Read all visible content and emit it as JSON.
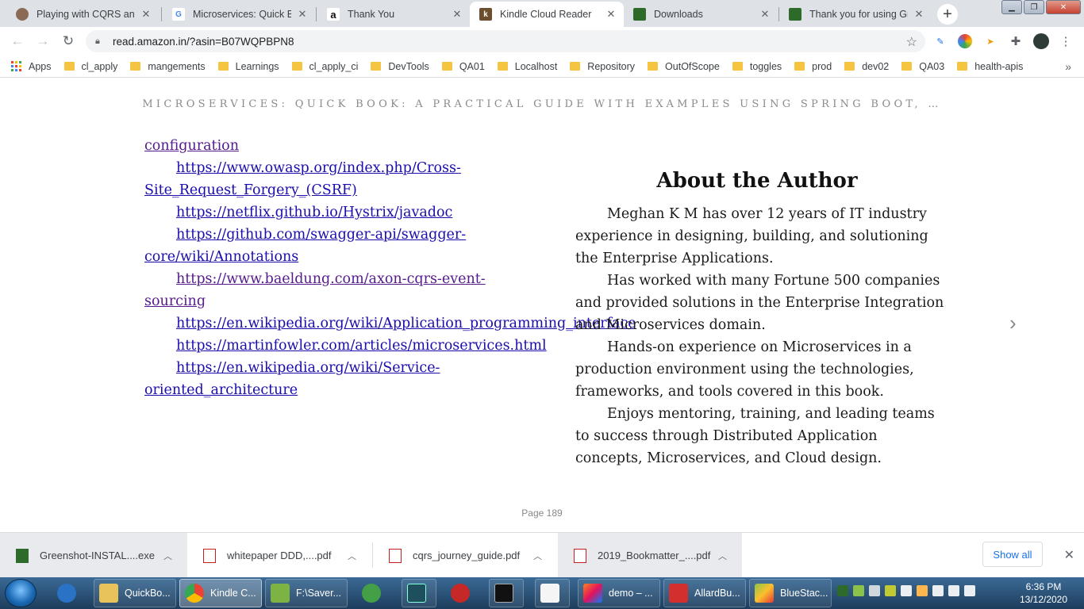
{
  "browser": {
    "tabs": [
      {
        "title": "Playing with CQRS and E",
        "favicon": "avatar-icon",
        "active": false
      },
      {
        "title": "Microservices: Quick Boo",
        "favicon": "google-icon",
        "active": false
      },
      {
        "title": "Thank You",
        "favicon": "amazon-icon",
        "active": false
      },
      {
        "title": "Kindle Cloud Reader",
        "favicon": "kindle-icon",
        "active": true
      },
      {
        "title": "Downloads",
        "favicon": "greenshot-icon",
        "active": false
      },
      {
        "title": "Thank you for using Gre",
        "favicon": "greenshot-icon",
        "active": false
      }
    ],
    "url": "read.amazon.in/?asin=B07WQPBPN8",
    "bookmarks": [
      {
        "label": "Apps",
        "icon": "apps-grid-icon"
      },
      {
        "label": "cl_apply",
        "icon": "folder-icon"
      },
      {
        "label": "mangements",
        "icon": "folder-icon"
      },
      {
        "label": "Learnings",
        "icon": "folder-icon"
      },
      {
        "label": "cl_apply_ci",
        "icon": "folder-icon"
      },
      {
        "label": "DevTools",
        "icon": "folder-icon"
      },
      {
        "label": "QA01",
        "icon": "folder-icon"
      },
      {
        "label": "Localhost",
        "icon": "folder-icon"
      },
      {
        "label": "Repository",
        "icon": "folder-icon"
      },
      {
        "label": "OutOfScope",
        "icon": "folder-icon"
      },
      {
        "label": "toggles",
        "icon": "folder-icon"
      },
      {
        "label": "prod",
        "icon": "folder-icon"
      },
      {
        "label": "dev02",
        "icon": "folder-icon"
      },
      {
        "label": "QA03",
        "icon": "folder-icon"
      },
      {
        "label": "health-apis",
        "icon": "folder-icon"
      }
    ]
  },
  "reader": {
    "book_title": "MICROSERVICES: QUICK BOOK: A PRACTICAL GUIDE WITH EXAMPLES USING SPRING BOOT, …",
    "left_column": {
      "first_line": "configuration",
      "links": [
        {
          "text": "https://www.owasp.org/index.php/Cross-Site_Request_Forgery_(CSRF)",
          "visited": false
        },
        {
          "text": "https://netflix.github.io/Hystrix/javadoc",
          "visited": false
        },
        {
          "text": "https://github.com/swagger-api/swagger-core/wiki/Annotations",
          "visited": false
        },
        {
          "text": "https://www.baeldung.com/axon-cqrs-event-sourcing",
          "visited": true
        },
        {
          "text": "https://en.wikipedia.org/wiki/Application_programming_interface",
          "visited": false
        },
        {
          "text": "https://martinfowler.com/articles/microservices.html",
          "visited": false
        },
        {
          "text": "https://en.wikipedia.org/wiki/Service-oriented_architecture",
          "visited": false
        }
      ]
    },
    "right_column": {
      "heading": "About the Author",
      "paragraphs": [
        "Meghan K M has over 12 years of IT industry experience in designing, building, and solutioning the Enterprise Applications.",
        "Has worked with many Fortune 500 companies and provided solutions in the Enterprise Integration and Microservices domain.",
        "Hands-on experience on Microservices in a production environment using the technologies, frameworks, and tools covered in this book.",
        "Enjoys mentoring, training, and leading teams to success through Distributed Application concepts, Microservices, and Cloud design."
      ]
    },
    "page_label": "Page 189"
  },
  "downloads": {
    "items": [
      {
        "name": "Greenshot-INSTAL....exe",
        "icon": "greenshot-icon"
      },
      {
        "name": "whitepaper DDD,....pdf",
        "icon": "pdf-icon"
      },
      {
        "name": "cqrs_journey_guide.pdf",
        "icon": "pdf-icon"
      },
      {
        "name": "2019_Bookmatter_....pdf",
        "icon": "pdf-icon"
      }
    ],
    "show_all": "Show all"
  },
  "taskbar": {
    "items": [
      {
        "label": "",
        "icon": "edge-like-icon"
      },
      {
        "label": "QuickBo...",
        "icon": "folder-icon"
      },
      {
        "label": "Kindle C...",
        "icon": "chrome-icon"
      },
      {
        "label": "F:\\Saver...",
        "icon": "notepad-icon"
      },
      {
        "label": "",
        "icon": "clock-app-icon"
      },
      {
        "label": "",
        "icon": "editor-icon"
      },
      {
        "label": "",
        "icon": "snipping-icon"
      },
      {
        "label": "",
        "icon": "terminal-icon"
      },
      {
        "label": "",
        "icon": "java-icon"
      },
      {
        "label": "demo – ...",
        "icon": "intellij-icon"
      },
      {
        "label": "AllardBu...",
        "icon": "acrobat-icon"
      },
      {
        "label": "BlueStac...",
        "icon": "bluestacks-icon"
      }
    ],
    "time": "6:36 PM",
    "date": "13/12/2020"
  },
  "colors": {
    "link": "#1a0dab",
    "link_visited": "#551a8b",
    "taskbar": "#1d3d5c",
    "accent": "#1a73e8"
  }
}
